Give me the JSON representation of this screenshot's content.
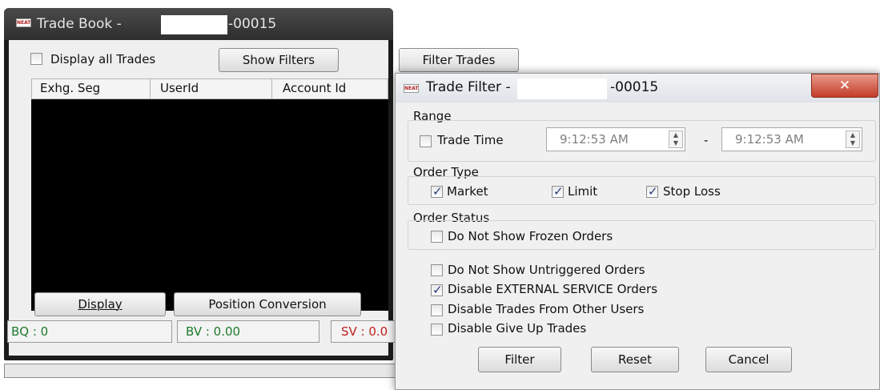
{
  "trade_book": {
    "logo_text": "NEAT",
    "title_prefix": "Trade Book -",
    "title_suffix": "-00015",
    "display_all_label": "Display all Trades",
    "show_filters_label": "Show Filters",
    "filter_trades_label": "Filter Trades",
    "columns": [
      "Exhg. Seg",
      "UserId",
      "Account Id"
    ],
    "display_button": "Display",
    "position_conversion_button": "Position Conversion",
    "bq": "BQ : 0",
    "bv": "BV : 0.00",
    "sv": "SV : 0.0"
  },
  "trade_filter": {
    "logo_text": "NEAT",
    "title_prefix": "Trade Filter -",
    "title_suffix": "-00015",
    "close_symbol": "✕",
    "range_label": "Range",
    "trade_time_label": "Trade Time",
    "trade_time_checked": false,
    "time_from": "9:12:53 AM",
    "time_separator": "-",
    "time_to": "9:12:53 AM",
    "order_type_label": "Order Type",
    "market_label": "Market",
    "market_checked": true,
    "limit_label": "Limit",
    "limit_checked": true,
    "stop_loss_label": "Stop Loss",
    "stop_loss_checked": true,
    "order_status_label": "Order Status",
    "frozen_label": "Do Not Show Frozen Orders",
    "frozen_checked": false,
    "untriggered_label": "Do Not Show Untriggered Orders",
    "untriggered_checked": false,
    "external_label": "Disable EXTERNAL SERVICE Orders",
    "external_checked": true,
    "other_users_label": "Disable Trades From Other Users",
    "other_users_checked": false,
    "give_up_label": "Disable Give Up Trades",
    "give_up_checked": false,
    "filter_button": "Filter",
    "reset_button": "Reset",
    "cancel_button": "Cancel"
  }
}
